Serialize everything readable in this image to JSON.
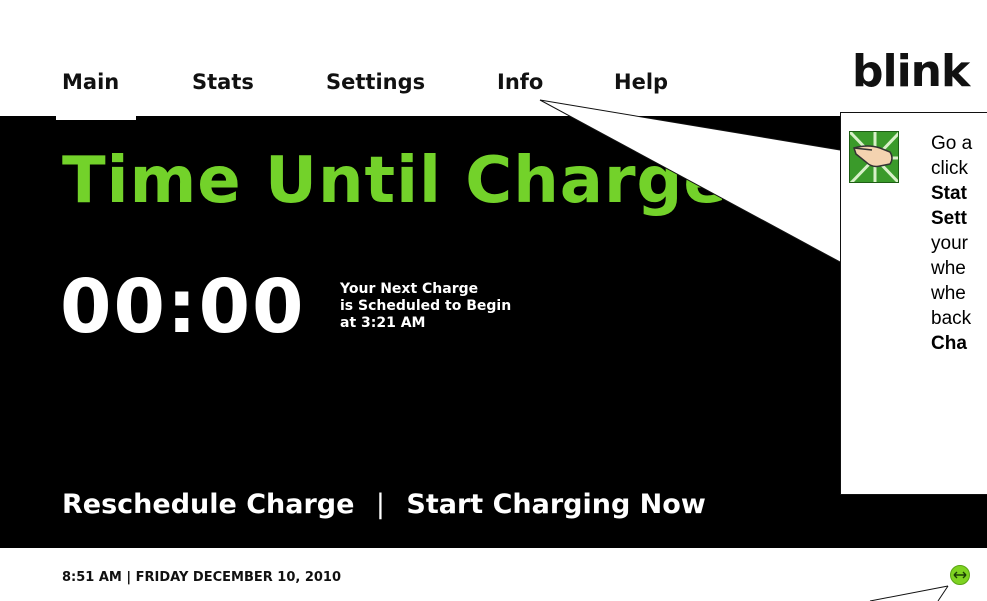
{
  "nav": {
    "items": [
      {
        "label": "Main",
        "active": true
      },
      {
        "label": "Stats",
        "active": false
      },
      {
        "label": "Settings",
        "active": false
      },
      {
        "label": "Info",
        "active": false
      },
      {
        "label": "Help",
        "active": false
      }
    ],
    "logo": "blink"
  },
  "main": {
    "headline": "Time Until Charge",
    "timer": "00:00",
    "schedule_lines": [
      "Your Next Charge",
      "is Scheduled to Begin",
      "at 3:21 AM"
    ],
    "reschedule_label": "Reschedule Charge",
    "separator": "|",
    "start_label": "Start Charging Now"
  },
  "footer": {
    "datetime": "8:51 AM | FRIDAY DECEMBER 10, 2010",
    "expand_icon": "expand-arrows-icon"
  },
  "callout": {
    "icon": "pointing-hand-icon",
    "lines": [
      {
        "text": "Go a",
        "bold": false
      },
      {
        "text": "click",
        "bold": false
      },
      {
        "text": "Stat",
        "bold": true
      },
      {
        "text": "Sett",
        "bold": true
      },
      {
        "text": "your",
        "bold": false
      },
      {
        "text": "whe",
        "bold": false
      },
      {
        "text": "whe",
        "bold": false
      },
      {
        "text": "back",
        "bold": false
      },
      {
        "text": "Cha",
        "bold": true
      }
    ]
  },
  "colors": {
    "accent_green": "#73d22a",
    "panel": "#000000",
    "text_light": "#ffffff"
  }
}
